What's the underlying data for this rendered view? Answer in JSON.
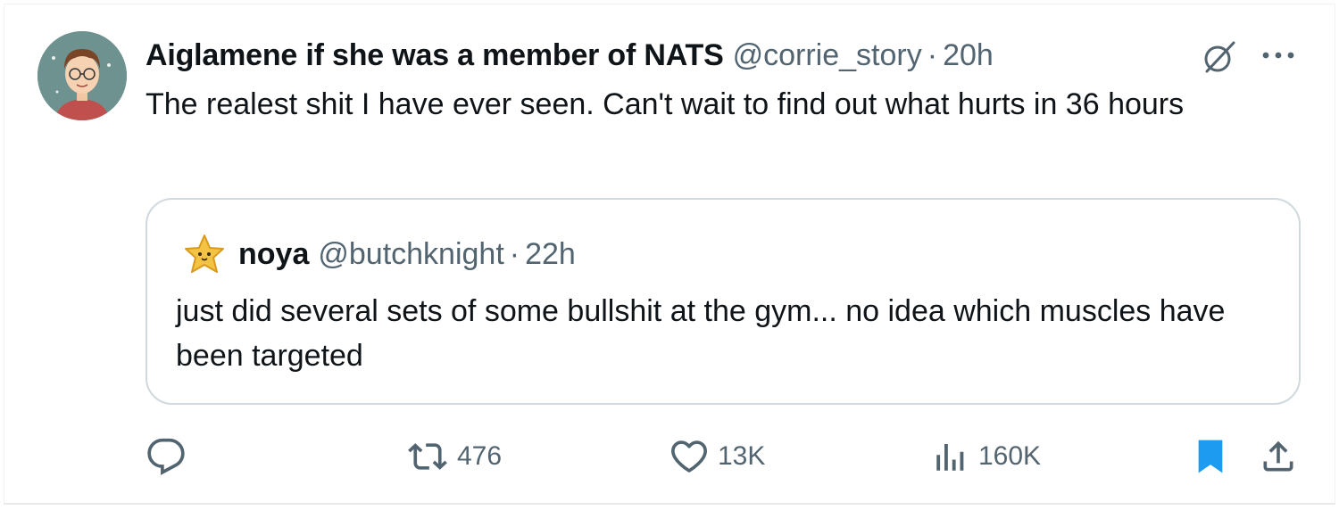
{
  "tweet": {
    "author_name": "Aiglamene if she was a member of NATS",
    "author_handle": "@corrie_story",
    "separator": "·",
    "time": "20h",
    "text": "The realest shit I have ever seen. Can't wait to find out what hurts in 36 hours"
  },
  "quoted_tweet": {
    "author_name": "noya",
    "author_handle": "@butchknight",
    "separator": "·",
    "time": "22h",
    "text": "just did several sets of some bullshit at the gym... no idea which muscles have been targeted"
  },
  "actions": {
    "reply_icon": "reply-icon",
    "retweet_count": "476",
    "like_count": "13K",
    "views_count": "160K",
    "bookmark_icon": "bookmark-icon",
    "share_icon": "share-icon"
  },
  "colors": {
    "text": "#0f1419",
    "secondary": "#536471",
    "border": "#cfd9de",
    "bookmark_active": "#1d9bf0"
  }
}
